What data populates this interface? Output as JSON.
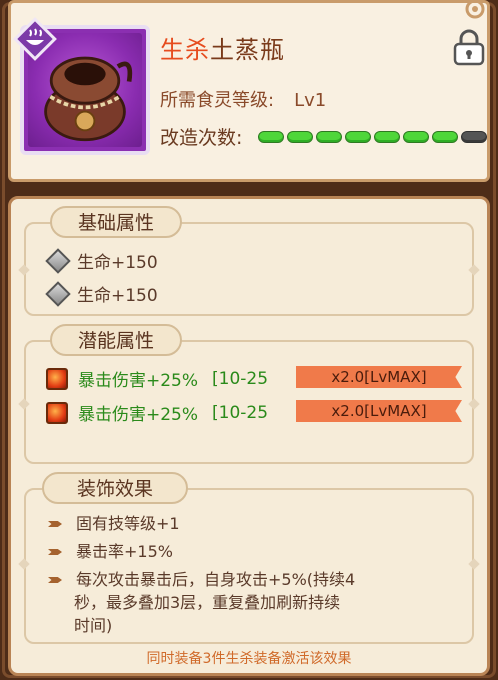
{
  "item": {
    "name_highlight": "生杀",
    "name_rest": "土蒸瓶",
    "requirement_label": "所需食灵等级:",
    "requirement_value": "Lv1",
    "modify_label": "改造次数:",
    "modify_progress": {
      "filled": 7,
      "total": 8
    },
    "badge_icon": "steam-bowl-icon",
    "icon": "clay-steam-pot-icon",
    "lock_icon": "lock-icon"
  },
  "base_attributes": {
    "title": "基础属性",
    "rows": [
      "生命+150",
      "生命+150"
    ]
  },
  "potential_attributes": {
    "title": "潜能属性",
    "rows": [
      {
        "text": "暴击伤害+25%",
        "range": "[10-25",
        "tag": "x2.0[LvMAX]"
      },
      {
        "text": "暴击伤害+25%",
        "range": "[10-25",
        "tag": "x2.0[LvMAX]"
      }
    ]
  },
  "decoration_effect": {
    "title": "装饰效果",
    "rows": [
      "固有技等级+1",
      "暴击率+15%",
      "每次攻击暴击后，自身攻击+5%(持续4",
      "秒，最多叠加3层，重复叠加刷新持续",
      "时间)"
    ]
  },
  "footer": "同时装备3件生杀装备激活该效果",
  "colors": {
    "highlight": "#e64c1e",
    "potential_tag": "#f07a4a",
    "progress_on": "#4fd63a",
    "progress_off": "#555555",
    "footer": "#d06a2a"
  }
}
